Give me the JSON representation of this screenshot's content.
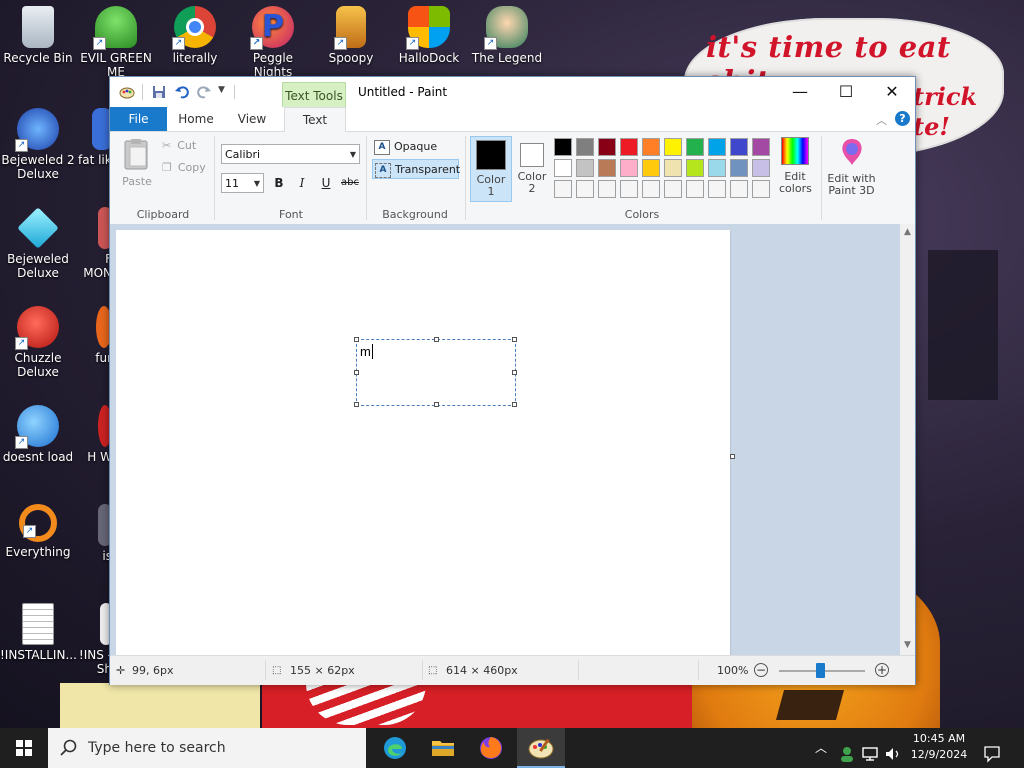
{
  "wallpaper": {
    "title_text": "it's time to eat shit",
    "side_text_1": "trick",
    "side_text_2": "te!"
  },
  "desktop_icons": [
    {
      "label": "Recycle Bin",
      "icon": "recycle-bin-icon"
    },
    {
      "label": "Bejeweled 2 Deluxe",
      "icon": "bejeweled2-icon"
    },
    {
      "label": "Bejeweled Deluxe",
      "icon": "bejeweled-icon"
    },
    {
      "label": "Chuzzle Deluxe",
      "icon": "chuzzle-icon"
    },
    {
      "label": "doesnt load",
      "icon": "thunderbird-icon"
    },
    {
      "label": "Everything",
      "icon": "everything-search-icon"
    },
    {
      "label": "!INSTALLIN...",
      "icon": "text-document-icon"
    },
    {
      "label": "EVIL GREEN ME",
      "icon": "evil-green-icon"
    },
    {
      "label": "literally",
      "icon": "chrome-icon"
    },
    {
      "label": "Peggle Nights",
      "icon": "peggle-icon"
    },
    {
      "label": "Spoopy",
      "icon": "spoopy-icon"
    },
    {
      "label": "HalloDock",
      "icon": "windows-logo-icon"
    },
    {
      "label": "The Legend",
      "icon": "legend-icon"
    },
    {
      "label": "fat lik",
      "icon": "partial-icon"
    },
    {
      "label": "F MON",
      "icon": "partial-icon"
    },
    {
      "label": "fur",
      "icon": "partial-icon"
    },
    {
      "label": "H W",
      "icon": "partial-icon"
    },
    {
      "label": "is",
      "icon": "partial-icon"
    },
    {
      "label": "!INS -Sh",
      "icon": "partial-icon"
    }
  ],
  "window": {
    "title": "Untitled - Paint",
    "contextual_tab": "Text Tools",
    "controls": {
      "minimize": "—",
      "maximize": "☐",
      "close": "✕"
    }
  },
  "tabs": [
    "File",
    "Home",
    "View",
    "Text"
  ],
  "ribbon": {
    "clipboard": {
      "paste": "Paste",
      "cut": "Cut",
      "copy": "Copy",
      "label": "Clipboard"
    },
    "font": {
      "family": "Calibri",
      "size": "11",
      "bold": "B",
      "italic": "I",
      "underline": "U",
      "strike": "abc",
      "label": "Font"
    },
    "background": {
      "opaque": "Opaque",
      "transparent": "Transparent",
      "label": "Background",
      "selected": "Transparent"
    },
    "colors": {
      "color1_label": "Color 1",
      "color2_label": "Color 2",
      "color1": "#000000",
      "color2": "#ffffff",
      "edit_colors": "Edit colors",
      "edit_paint3d": "Edit with Paint 3D",
      "label": "Colors",
      "palette_row1": [
        "#000000",
        "#7f7f7f",
        "#880015",
        "#ed1c24",
        "#ff7f27",
        "#fff200",
        "#22b14c",
        "#00a2e8",
        "#3f48cc",
        "#a349a4"
      ],
      "palette_row2": [
        "#ffffff",
        "#c3c3c3",
        "#b97a57",
        "#ffaec9",
        "#ffc90e",
        "#efe4b0",
        "#b5e61d",
        "#99d9ea",
        "#7092be",
        "#c8bfe7"
      ],
      "palette_row3": [
        "#f5f5f5",
        "#f5f5f5",
        "#f5f5f5",
        "#f5f5f5",
        "#f5f5f5",
        "#f5f5f5",
        "#f5f5f5",
        "#f5f5f5",
        "#f5f5f5",
        "#f5f5f5"
      ]
    }
  },
  "canvas": {
    "typed_text": "m"
  },
  "status": {
    "cursor_pos": "99, 6px",
    "selection_size": "155 × 62px",
    "image_size": "614 × 460px",
    "zoom": "100%"
  },
  "taskbar": {
    "search_placeholder": "Type here to search",
    "time": "10:45 AM",
    "date": "12/9/2024"
  }
}
